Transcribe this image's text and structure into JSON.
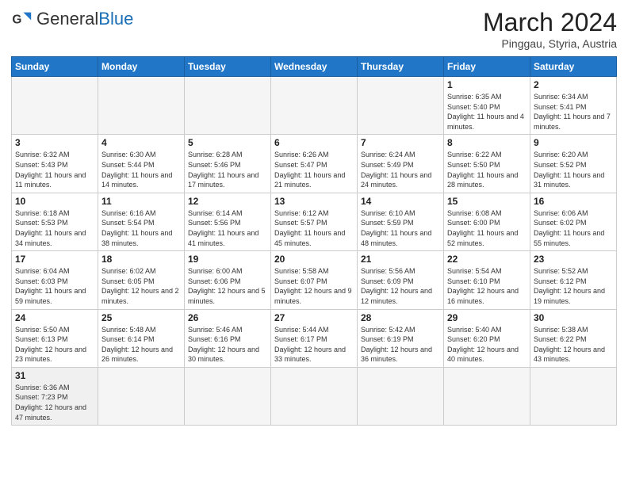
{
  "header": {
    "logo_general": "General",
    "logo_blue": "Blue",
    "month_year": "March 2024",
    "location": "Pinggau, Styria, Austria"
  },
  "weekdays": [
    "Sunday",
    "Monday",
    "Tuesday",
    "Wednesday",
    "Thursday",
    "Friday",
    "Saturday"
  ],
  "weeks": [
    [
      {
        "day": "",
        "info": "",
        "empty": true
      },
      {
        "day": "",
        "info": "",
        "empty": true
      },
      {
        "day": "",
        "info": "",
        "empty": true
      },
      {
        "day": "",
        "info": "",
        "empty": true
      },
      {
        "day": "",
        "info": "",
        "empty": true
      },
      {
        "day": "1",
        "info": "Sunrise: 6:35 AM\nSunset: 5:40 PM\nDaylight: 11 hours and 4 minutes.",
        "empty": false
      },
      {
        "day": "2",
        "info": "Sunrise: 6:34 AM\nSunset: 5:41 PM\nDaylight: 11 hours and 7 minutes.",
        "empty": false
      }
    ],
    [
      {
        "day": "3",
        "info": "Sunrise: 6:32 AM\nSunset: 5:43 PM\nDaylight: 11 hours and 11 minutes.",
        "empty": false
      },
      {
        "day": "4",
        "info": "Sunrise: 6:30 AM\nSunset: 5:44 PM\nDaylight: 11 hours and 14 minutes.",
        "empty": false
      },
      {
        "day": "5",
        "info": "Sunrise: 6:28 AM\nSunset: 5:46 PM\nDaylight: 11 hours and 17 minutes.",
        "empty": false
      },
      {
        "day": "6",
        "info": "Sunrise: 6:26 AM\nSunset: 5:47 PM\nDaylight: 11 hours and 21 minutes.",
        "empty": false
      },
      {
        "day": "7",
        "info": "Sunrise: 6:24 AM\nSunset: 5:49 PM\nDaylight: 11 hours and 24 minutes.",
        "empty": false
      },
      {
        "day": "8",
        "info": "Sunrise: 6:22 AM\nSunset: 5:50 PM\nDaylight: 11 hours and 28 minutes.",
        "empty": false
      },
      {
        "day": "9",
        "info": "Sunrise: 6:20 AM\nSunset: 5:52 PM\nDaylight: 11 hours and 31 minutes.",
        "empty": false
      }
    ],
    [
      {
        "day": "10",
        "info": "Sunrise: 6:18 AM\nSunset: 5:53 PM\nDaylight: 11 hours and 34 minutes.",
        "empty": false
      },
      {
        "day": "11",
        "info": "Sunrise: 6:16 AM\nSunset: 5:54 PM\nDaylight: 11 hours and 38 minutes.",
        "empty": false
      },
      {
        "day": "12",
        "info": "Sunrise: 6:14 AM\nSunset: 5:56 PM\nDaylight: 11 hours and 41 minutes.",
        "empty": false
      },
      {
        "day": "13",
        "info": "Sunrise: 6:12 AM\nSunset: 5:57 PM\nDaylight: 11 hours and 45 minutes.",
        "empty": false
      },
      {
        "day": "14",
        "info": "Sunrise: 6:10 AM\nSunset: 5:59 PM\nDaylight: 11 hours and 48 minutes.",
        "empty": false
      },
      {
        "day": "15",
        "info": "Sunrise: 6:08 AM\nSunset: 6:00 PM\nDaylight: 11 hours and 52 minutes.",
        "empty": false
      },
      {
        "day": "16",
        "info": "Sunrise: 6:06 AM\nSunset: 6:02 PM\nDaylight: 11 hours and 55 minutes.",
        "empty": false
      }
    ],
    [
      {
        "day": "17",
        "info": "Sunrise: 6:04 AM\nSunset: 6:03 PM\nDaylight: 11 hours and 59 minutes.",
        "empty": false
      },
      {
        "day": "18",
        "info": "Sunrise: 6:02 AM\nSunset: 6:05 PM\nDaylight: 12 hours and 2 minutes.",
        "empty": false
      },
      {
        "day": "19",
        "info": "Sunrise: 6:00 AM\nSunset: 6:06 PM\nDaylight: 12 hours and 5 minutes.",
        "empty": false
      },
      {
        "day": "20",
        "info": "Sunrise: 5:58 AM\nSunset: 6:07 PM\nDaylight: 12 hours and 9 minutes.",
        "empty": false
      },
      {
        "day": "21",
        "info": "Sunrise: 5:56 AM\nSunset: 6:09 PM\nDaylight: 12 hours and 12 minutes.",
        "empty": false
      },
      {
        "day": "22",
        "info": "Sunrise: 5:54 AM\nSunset: 6:10 PM\nDaylight: 12 hours and 16 minutes.",
        "empty": false
      },
      {
        "day": "23",
        "info": "Sunrise: 5:52 AM\nSunset: 6:12 PM\nDaylight: 12 hours and 19 minutes.",
        "empty": false
      }
    ],
    [
      {
        "day": "24",
        "info": "Sunrise: 5:50 AM\nSunset: 6:13 PM\nDaylight: 12 hours and 23 minutes.",
        "empty": false
      },
      {
        "day": "25",
        "info": "Sunrise: 5:48 AM\nSunset: 6:14 PM\nDaylight: 12 hours and 26 minutes.",
        "empty": false
      },
      {
        "day": "26",
        "info": "Sunrise: 5:46 AM\nSunset: 6:16 PM\nDaylight: 12 hours and 30 minutes.",
        "empty": false
      },
      {
        "day": "27",
        "info": "Sunrise: 5:44 AM\nSunset: 6:17 PM\nDaylight: 12 hours and 33 minutes.",
        "empty": false
      },
      {
        "day": "28",
        "info": "Sunrise: 5:42 AM\nSunset: 6:19 PM\nDaylight: 12 hours and 36 minutes.",
        "empty": false
      },
      {
        "day": "29",
        "info": "Sunrise: 5:40 AM\nSunset: 6:20 PM\nDaylight: 12 hours and 40 minutes.",
        "empty": false
      },
      {
        "day": "30",
        "info": "Sunrise: 5:38 AM\nSunset: 6:22 PM\nDaylight: 12 hours and 43 minutes.",
        "empty": false
      }
    ],
    [
      {
        "day": "31",
        "info": "Sunrise: 6:36 AM\nSunset: 7:23 PM\nDaylight: 12 hours and 47 minutes.",
        "empty": false
      },
      {
        "day": "",
        "info": "",
        "empty": true
      },
      {
        "day": "",
        "info": "",
        "empty": true
      },
      {
        "day": "",
        "info": "",
        "empty": true
      },
      {
        "day": "",
        "info": "",
        "empty": true
      },
      {
        "day": "",
        "info": "",
        "empty": true
      },
      {
        "day": "",
        "info": "",
        "empty": true
      }
    ]
  ]
}
